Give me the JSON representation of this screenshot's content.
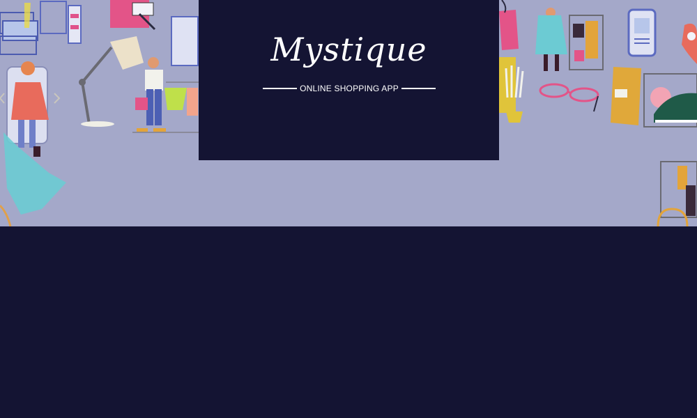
{
  "brand": {
    "name": "Mystique",
    "tagline": "ONLINE SHOPPING APP"
  },
  "colors": {
    "hero_background": "#a4a8c9",
    "dark_background": "#141433",
    "logo_text": "#ffffff"
  },
  "hero": {
    "carousel_prev_icon": "chevron-left-icon",
    "carousel_next_icon": "chevron-right-icon"
  }
}
